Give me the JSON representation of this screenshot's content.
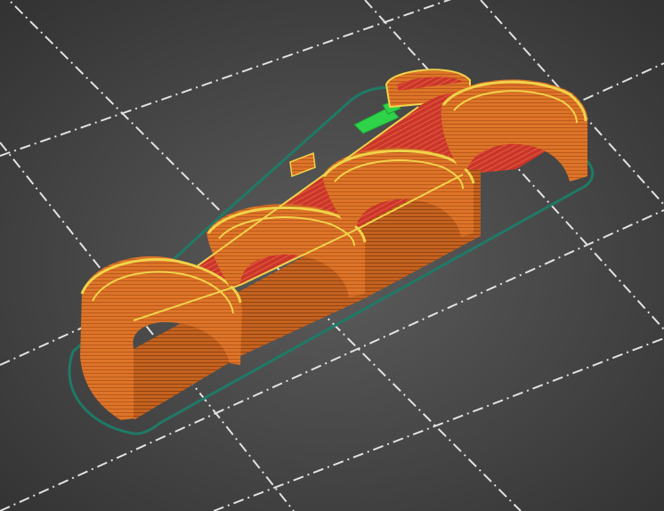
{
  "app": {
    "view": "slicer-preview-3d"
  },
  "scene": {
    "background_center": "#5c5c5c",
    "background_edge": "#333333",
    "grid_line_color": "#f4f4f4",
    "grid_line_style": "dash-dot",
    "skirt_color": "#1f7a66",
    "object": {
      "name": "",
      "semicircular_cradles": 4,
      "colors": {
        "external_perimeter": "#e3782a",
        "perimeter_shadow": "#a84e18",
        "infill": "#c9352a",
        "top_edge": "#f0d34a",
        "support_material": "#2fd34a"
      }
    }
  }
}
